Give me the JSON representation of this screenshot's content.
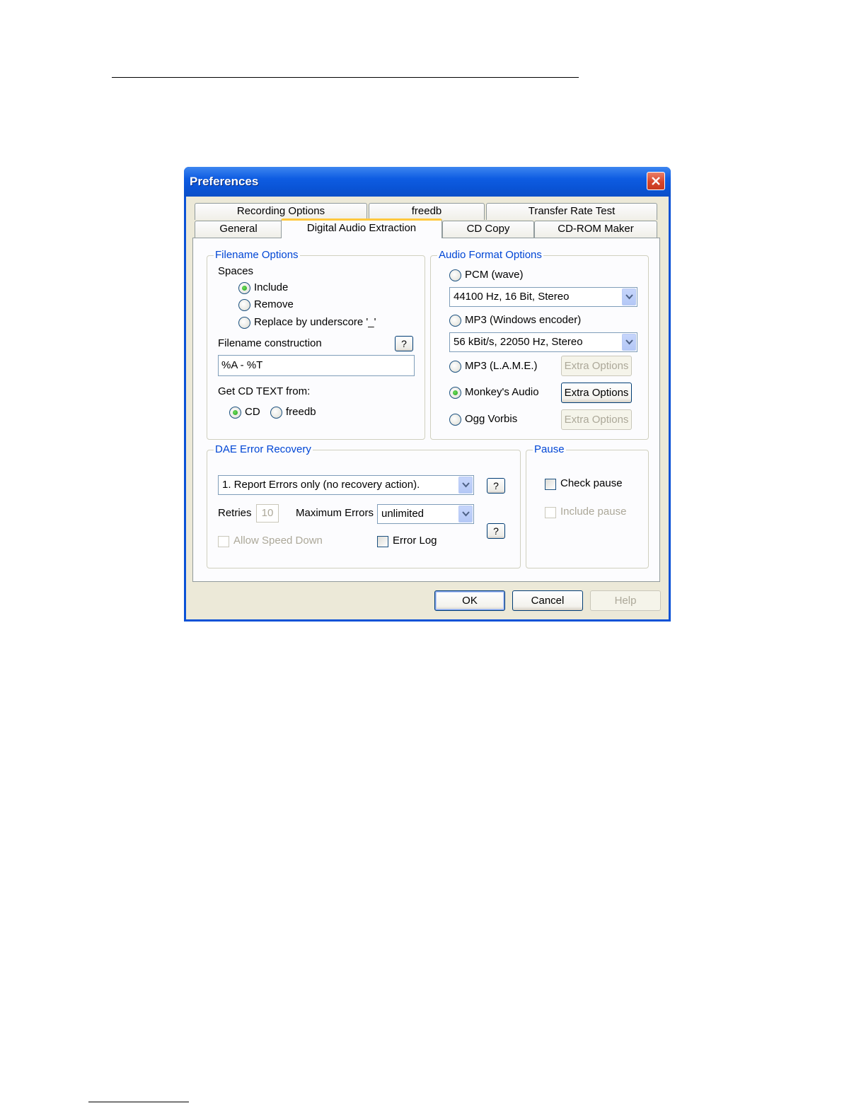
{
  "window": {
    "title": "Preferences"
  },
  "tabs": {
    "row1": [
      "Recording Options",
      "freedb",
      "Transfer Rate Test"
    ],
    "row2": [
      "General",
      "Digital Audio Extraction",
      "CD Copy",
      "CD-ROM Maker"
    ],
    "active": "Digital Audio Extraction"
  },
  "filename_options": {
    "title": "Filename Options",
    "spaces_label": "Spaces",
    "spaces_options": [
      {
        "label": "Include",
        "checked": true
      },
      {
        "label": "Remove",
        "checked": false
      },
      {
        "label": "Replace by underscore '_'",
        "checked": false
      }
    ],
    "construction_label": "Filename construction",
    "help_label": "?",
    "construction_value": "%A - %T",
    "cdtext_label": "Get CD TEXT from:",
    "cdtext_options": [
      {
        "label": "CD",
        "checked": true
      },
      {
        "label": "freedb",
        "checked": false
      }
    ]
  },
  "audio_format": {
    "title": "Audio Format Options",
    "pcm_label": "PCM (wave)",
    "pcm_setting": "44100 Hz, 16 Bit, Stereo",
    "mp3win_label": "MP3 (Windows encoder)",
    "mp3win_setting": "56 kBit/s, 22050 Hz, Stereo",
    "lame_label": "MP3 (L.A.M.E.)",
    "monkey_label": "Monkey's Audio",
    "ogg_label": "Ogg Vorbis",
    "extra_options_label": "Extra Options",
    "selected": "Monkey's Audio"
  },
  "dae_error_recovery": {
    "title": "DAE Error Recovery",
    "mode_value": "1. Report Errors only (no recovery action).",
    "retries_label": "Retries",
    "retries_value": "10",
    "max_errors_label": "Maximum Errors",
    "max_errors_value": "unlimited",
    "allow_speed_down_label": "Allow Speed Down",
    "error_log_label": "Error Log",
    "help_label": "?"
  },
  "pause": {
    "title": "Pause",
    "check_pause_label": "Check pause",
    "include_pause_label": "Include pause"
  },
  "footer": {
    "ok_label": "OK",
    "cancel_label": "Cancel",
    "help_label": "Help"
  }
}
